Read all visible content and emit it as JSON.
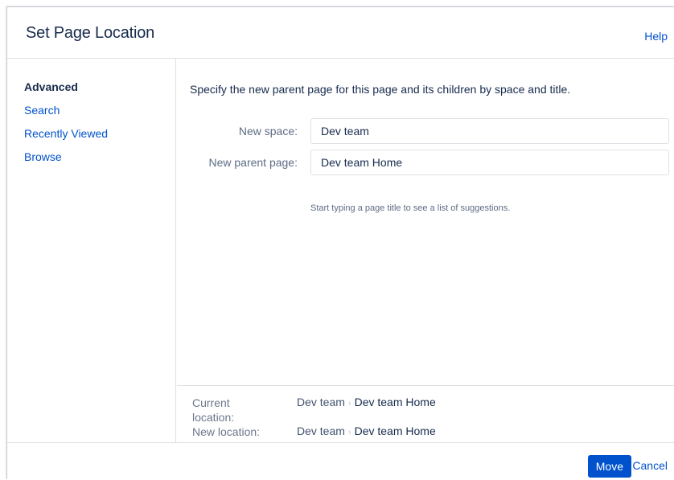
{
  "dialog": {
    "title": "Set Page Location",
    "help_label": "Help"
  },
  "sidebar": {
    "items": [
      {
        "label": "Advanced",
        "active": true
      },
      {
        "label": "Search",
        "active": false
      },
      {
        "label": "Recently Viewed",
        "active": false
      },
      {
        "label": "Browse",
        "active": false
      }
    ]
  },
  "main": {
    "instructions": "Specify the new parent page for this page and its children by space and title.",
    "space_label": "New space:",
    "space_value": "Dev team",
    "parent_label": "New parent page:",
    "parent_value": "Dev team Home",
    "hint": "Start typing a page title to see a list of suggestions."
  },
  "location": {
    "current_label": "Current location:",
    "current_space": "Dev team",
    "current_page": "Dev team Home",
    "new_label": "New location:",
    "new_space": "Dev team",
    "new_page": "Dev team Home",
    "separator": "›"
  },
  "footer": {
    "move_label": "Move",
    "cancel_label": "Cancel"
  },
  "colors": {
    "accent": "#0052cc",
    "text": "#172b4d",
    "muted": "#5e6c84",
    "border": "#dfe1e6"
  }
}
